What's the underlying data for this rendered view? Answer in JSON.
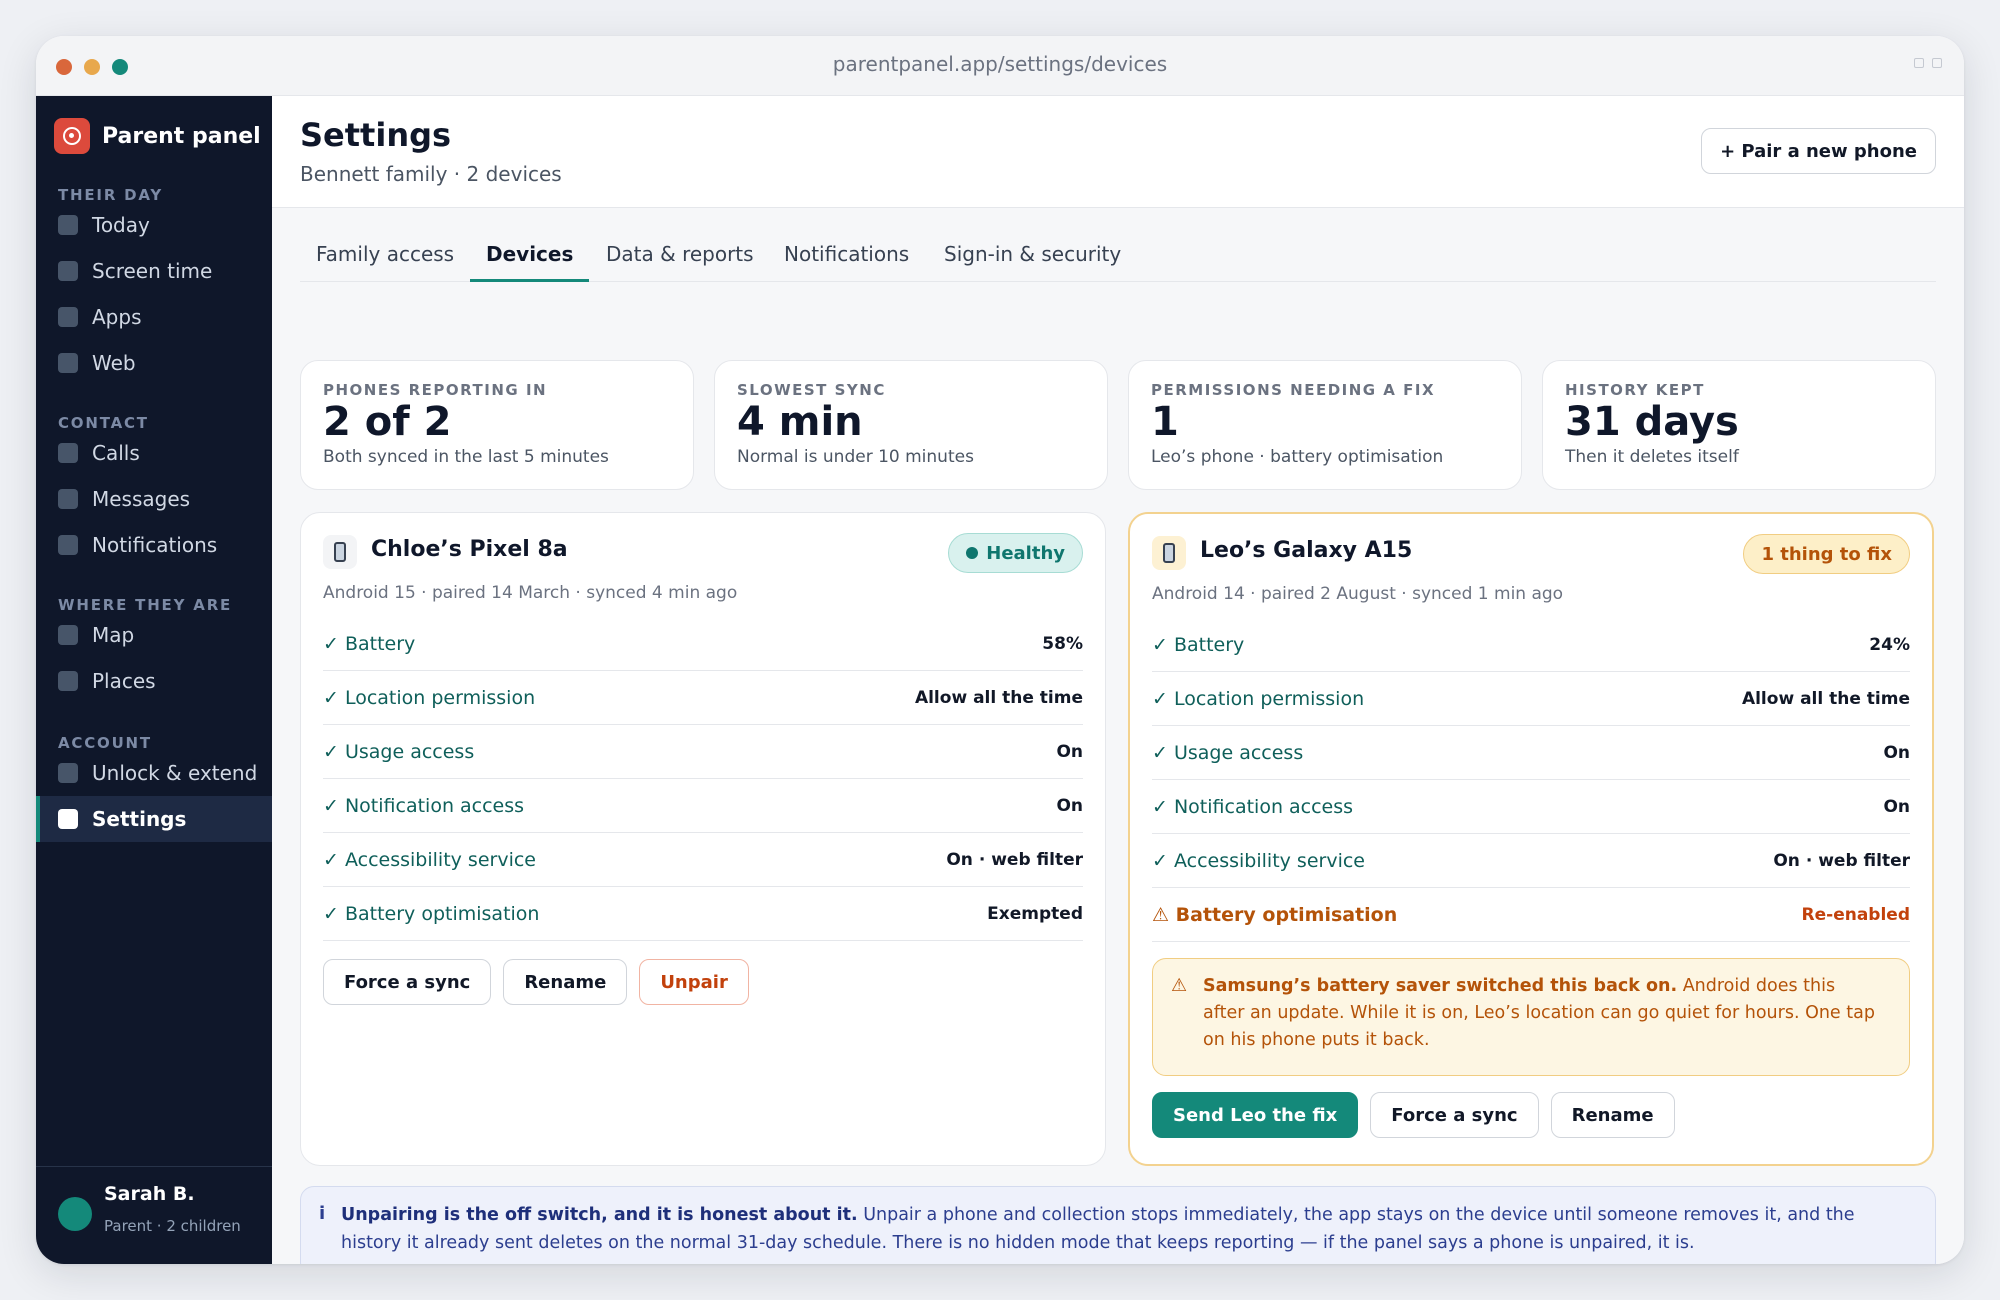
{
  "window": {
    "url": "parentpanel.app/settings/devices"
  },
  "sidebar": {
    "brand": "Parent panel",
    "sections": [
      {
        "title": "THEIR DAY",
        "items": [
          "Today",
          "Screen time",
          "Apps",
          "Web"
        ]
      },
      {
        "title": "CONTACT",
        "items": [
          "Calls",
          "Messages",
          "Notifications"
        ]
      },
      {
        "title": "WHERE THEY ARE",
        "items": [
          "Map",
          "Places"
        ]
      },
      {
        "title": "ACCOUNT",
        "items": [
          "Unlock & extend",
          "Settings"
        ]
      }
    ],
    "active_item": "Settings",
    "user": {
      "name": "Sarah B.",
      "role": "Parent · 2 children"
    }
  },
  "header": {
    "title": "Settings",
    "subtitle": "Bennett family · 2 devices",
    "pair_button": "+ Pair a new phone"
  },
  "tabs": [
    "Family access",
    "Devices",
    "Data & reports",
    "Notifications",
    "Sign-in & security"
  ],
  "active_tab": "Devices",
  "stats": [
    {
      "label": "PHONES REPORTING IN",
      "value": "2 of 2",
      "note": "Both synced in the last 5 minutes"
    },
    {
      "label": "SLOWEST SYNC",
      "value": "4 min",
      "note": "Normal is under 10 minutes"
    },
    {
      "label": "PERMISSIONS NEEDING A FIX",
      "value": "1",
      "note": "Leo’s phone · battery optimisation"
    },
    {
      "label": "HISTORY KEPT",
      "value": "31 days",
      "note": "Then it deletes itself"
    }
  ],
  "devices": [
    {
      "name": "Chloe’s Pixel 8a",
      "status": "Healthy",
      "meta": "Android 15 · paired 14 March · synced 4 min ago",
      "rows": [
        {
          "icon": "✓",
          "label": "Battery",
          "value": "58%"
        },
        {
          "icon": "✓",
          "label": "Location permission",
          "value": "Allow all the time"
        },
        {
          "icon": "✓",
          "label": "Usage access",
          "value": "On"
        },
        {
          "icon": "✓",
          "label": "Notification access",
          "value": "On"
        },
        {
          "icon": "✓",
          "label": "Accessibility service",
          "value": "On · web filter"
        },
        {
          "icon": "✓",
          "label": "Battery optimisation",
          "value": "Exempted"
        }
      ],
      "buttons": [
        "Force a sync",
        "Rename",
        "Unpair"
      ]
    },
    {
      "name": "Leo’s Galaxy A15",
      "status": "1 thing to fix",
      "meta": "Android 14 · paired 2 August · synced 1 min ago",
      "rows": [
        {
          "icon": "✓",
          "label": "Battery",
          "value": "24%"
        },
        {
          "icon": "✓",
          "label": "Location permission",
          "value": "Allow all the time"
        },
        {
          "icon": "✓",
          "label": "Usage access",
          "value": "On"
        },
        {
          "icon": "✓",
          "label": "Notification access",
          "value": "On"
        },
        {
          "icon": "✓",
          "label": "Accessibility service",
          "value": "On · web filter"
        },
        {
          "icon": "⚠",
          "label": "Battery optimisation",
          "value": "Re-enabled"
        }
      ],
      "warning": {
        "icon": "⚠",
        "bold": "Samsung’s battery saver switched this back on.",
        "text": " Android does this after an update. While it is on, Leo’s location can go quiet for hours. One tap on his phone puts it back."
      },
      "buttons": [
        "Send Leo the fix",
        "Force a sync",
        "Rename"
      ]
    }
  ],
  "info": {
    "icon": "i",
    "bold": "Unpairing is the off switch, and it is honest about it.",
    "text": " Unpair a phone and collection stops immediately, the app stays on the device until someone removes it, and the history it already sent deletes on the normal 31-day schedule. There is no hidden mode that keeps reporting — if the panel says a phone is unpaired, it is."
  },
  "colors": {
    "accent": "#14897a",
    "warning": "#b45309",
    "danger": "#c2410c",
    "sidebar": "#0f172a"
  }
}
